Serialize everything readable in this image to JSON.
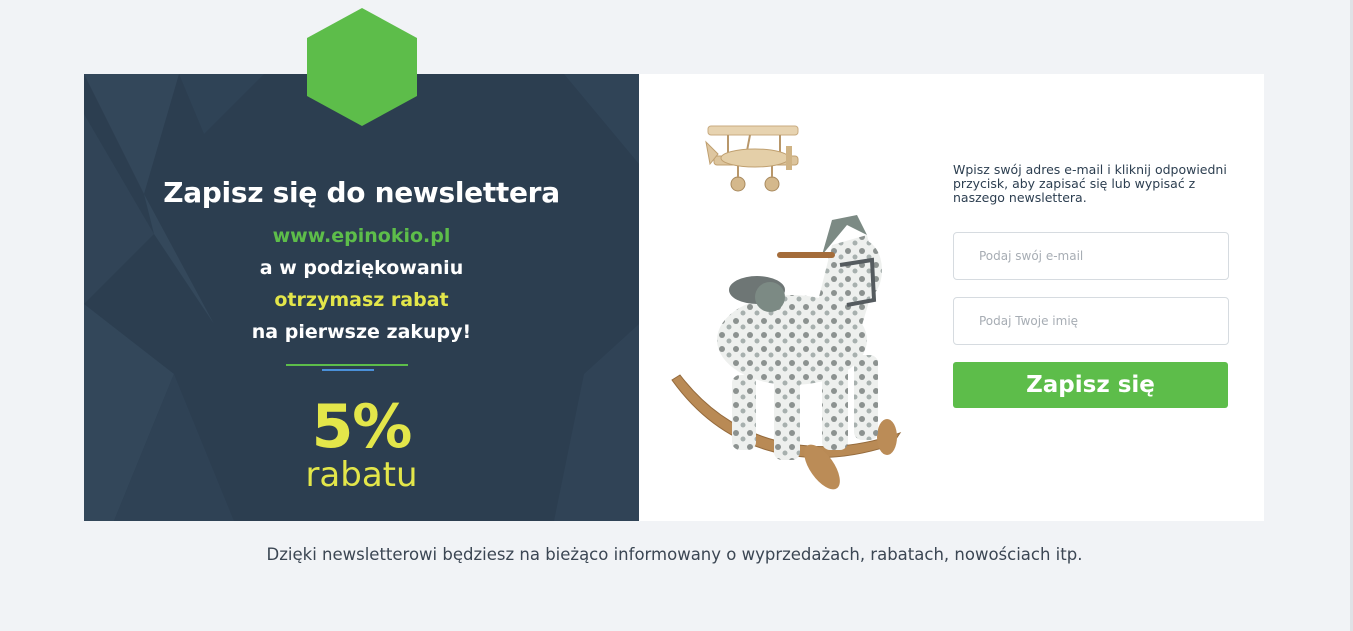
{
  "promo": {
    "headline": "Zapisz się do newslettera",
    "site": "www.epinokio.pl",
    "thanks_line": "a w podziękowaniu",
    "discount_line": "otrzymasz rabat",
    "first_purchase_line": "na pierwsze zakupy!",
    "discount_value": "5%",
    "discount_word": "rabatu"
  },
  "form": {
    "instruction": "Wpisz swój adres e-mail i kliknij odpowiedni przycisk, aby zapisać się lub wypisać z naszego newslettera.",
    "email_placeholder": "Podaj swój e-mail",
    "name_placeholder": "Podaj Twoje imię",
    "submit_label": "Zapisz się"
  },
  "footer": {
    "text": "Dzięki newsletterowi będziesz na bieżąco informowany o wyprzedażach, rabatach, nowościach itp."
  },
  "colors": {
    "dark_panel": "#2c3e50",
    "accent_green": "#5dbd4a",
    "accent_yellow": "#e3e64a",
    "divider_blue": "#4a90d9"
  },
  "icons": {
    "badge": "green-hexagon",
    "product_airplane": "wooden-biplane-toy",
    "product_horse": "plush-rocking-horse"
  }
}
